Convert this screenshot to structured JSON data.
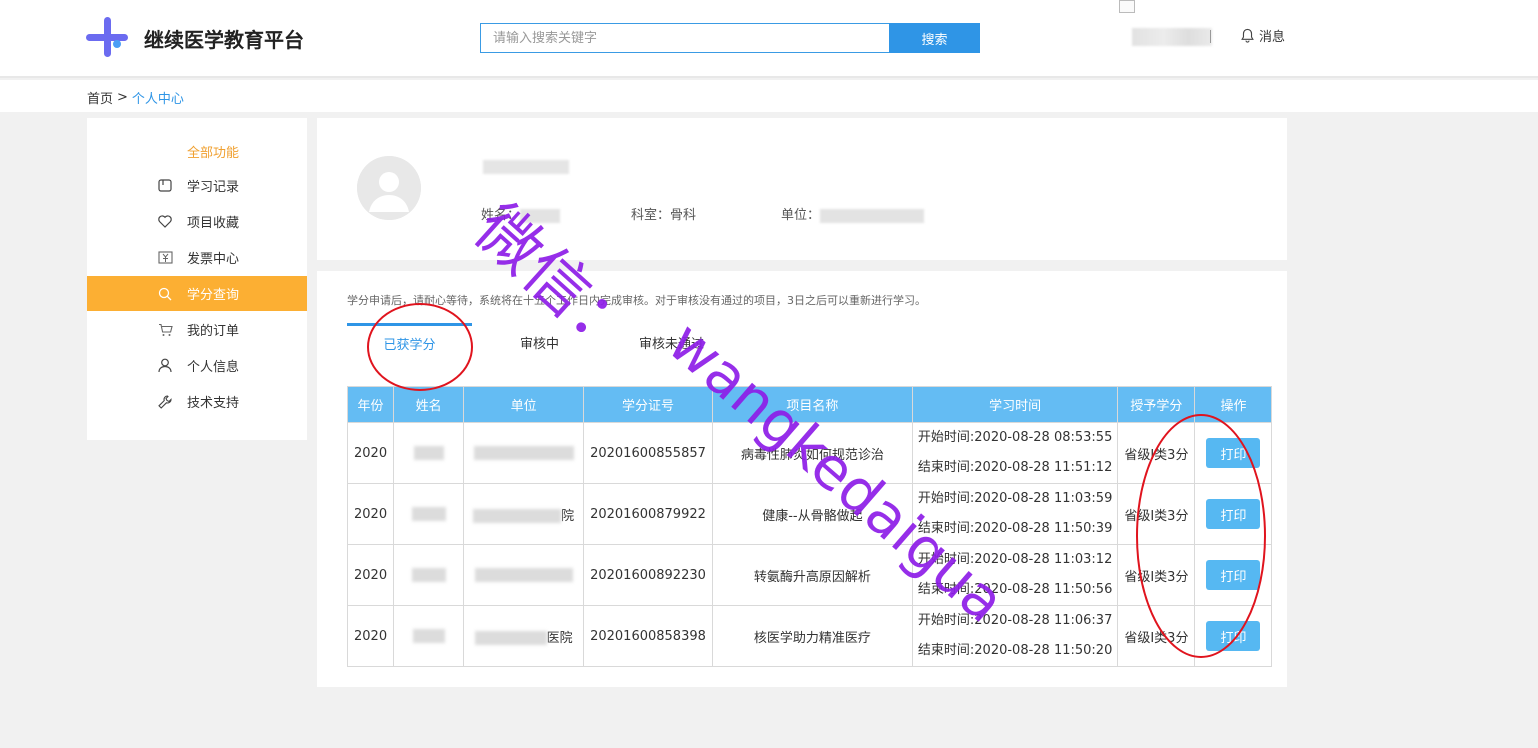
{
  "header": {
    "logo_text": "继续医学教育平台",
    "search_placeholder": "请输入搜索关键字",
    "search_button": "搜索",
    "message_label": "消息"
  },
  "breadcrumb": {
    "home": "首页",
    "separator": ">",
    "current": "个人中心"
  },
  "sidebar": {
    "title": "全部功能",
    "items": [
      {
        "label": "学习记录",
        "icon": "book-icon"
      },
      {
        "label": "项目收藏",
        "icon": "heart-icon"
      },
      {
        "label": "发票中心",
        "icon": "invoice-icon"
      },
      {
        "label": "学分查询",
        "icon": "search-icon",
        "active": true
      },
      {
        "label": "我的订单",
        "icon": "cart-icon"
      },
      {
        "label": "个人信息",
        "icon": "user-icon"
      },
      {
        "label": "技术支持",
        "icon": "wrench-icon"
      }
    ]
  },
  "profile": {
    "name_label": "姓名：",
    "dept_label": "科室：",
    "dept_value": "骨科",
    "unit_label": "单位："
  },
  "credits": {
    "notice": "学分申请后，请耐心等待，系统将在十五个工作日内完成审核。对于审核没有通过的项目，3日之后可以重新进行学习。",
    "tabs": [
      "已获学分",
      "审核中",
      "审核未通过"
    ],
    "active_tab": 0,
    "columns": [
      "年份",
      "姓名",
      "单位",
      "学分证号",
      "项目名称",
      "学习时间",
      "授予学分",
      "操作"
    ],
    "rows": [
      {
        "year": "2020",
        "unit_suffix": "",
        "cert_no": "20201600855857",
        "project": "病毒性肺炎如何规范诊治",
        "start": "开始时间:2020-08-28 08:53:55",
        "end": "结束时间:2020-08-28 11:51:12",
        "credit": "省级I类3分",
        "action": "打印"
      },
      {
        "year": "2020",
        "unit_suffix": "院",
        "cert_no": "20201600879922",
        "project": "健康--从骨骼做起",
        "start": "开始时间:2020-08-28 11:03:59",
        "end": "结束时间:2020-08-28 11:50:39",
        "credit": "省级I类3分",
        "action": "打印"
      },
      {
        "year": "2020",
        "unit_suffix": "",
        "cert_no": "20201600892230",
        "project": "转氨酶升高原因解析",
        "start": "开始时间:2020-08-28 11:03:12",
        "end": "结束时间:2020-08-28 11:50:56",
        "credit": "省级I类3分",
        "action": "打印"
      },
      {
        "year": "2020",
        "unit_suffix": "医院",
        "cert_no": "20201600858398",
        "project": "核医学助力精准医疗",
        "start": "开始时间:2020-08-28 11:06:37",
        "end": "结束时间:2020-08-28 11:50:20",
        "credit": "省级I类3分",
        "action": "打印"
      }
    ]
  },
  "watermark": {
    "line1": "微信：",
    "line2": "wangkedaigua"
  },
  "colors": {
    "accent_blue": "#2f95e6",
    "table_header": "#64bcf3",
    "active_orange": "#fcaf33",
    "annotation_red": "#e0141e",
    "watermark_purple": "#8e1de8"
  }
}
